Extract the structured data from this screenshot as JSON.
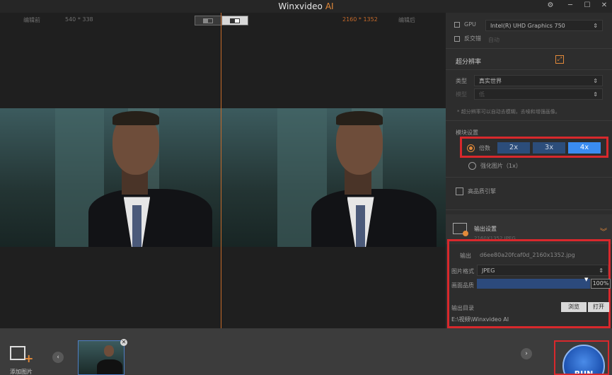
{
  "window": {
    "title": "Winxvideo",
    "title_accent": "AI",
    "settings_icon": "gear-icon",
    "minimize_icon": "minimize-icon",
    "maximize_icon": "maximize-icon",
    "close_icon": "close-icon"
  },
  "preview": {
    "left_label": "编辑前",
    "left_size": "540 * 338",
    "right_size": "2160 * 1352",
    "right_label": "编辑后",
    "accent_color": "#c66a2a"
  },
  "panel": {
    "gpu_label": "GPU",
    "gpu_value": "Intel(R) UHD Graphics 750",
    "interlace_label": "反交错",
    "interlace_value": "自动",
    "section_title": "超分辨率",
    "type_label": "类型",
    "type_value": "真实世界",
    "model_label": "模型",
    "model_value": "低",
    "hint": "* 超分辨率可以自动去模糊，去噪和增强画像。",
    "scale_section": "模块设置",
    "scale_label": "倍数",
    "scale_options": [
      "2x",
      "3x",
      "4x"
    ],
    "scale_active": "4x",
    "low_res_label": "强化图片（1x）",
    "high_quality_label": "高品质引擎",
    "output_section": "输出设置",
    "output_summary": "2160X1352 JPEG",
    "output_label": "输出",
    "output_filename": "d6ee80a20fcaf0d_2160x1352.jpg",
    "format_label": "图片格式",
    "format_value": "JPEG",
    "quality_label": "画面品质",
    "quality_value": "100%",
    "quality_level": 1.0,
    "dir_label": "输出目录",
    "browse_label": "浏览",
    "open_label": "打开",
    "dir_path": "E:\\视频\\Winxvideo AI",
    "highlight_color": "#d8282c",
    "active_blue": "#3a8cf1"
  },
  "bottom": {
    "add_label": "添加图片",
    "run_label": "RUN"
  }
}
